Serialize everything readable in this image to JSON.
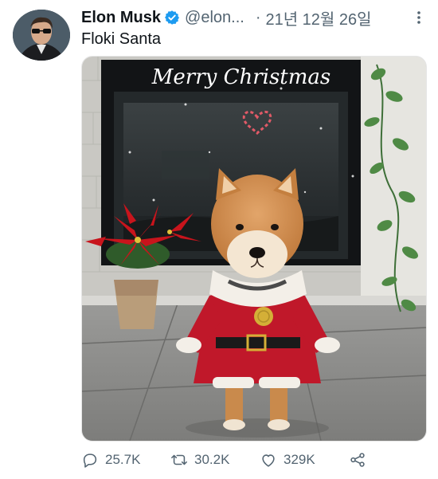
{
  "author": {
    "name": "Elon Musk",
    "handle": "@elon...",
    "verified": true
  },
  "timestamp": "21년 12월 26일",
  "separator": "·",
  "tweet": {
    "text": "Floki Santa",
    "image_overlay_text": "Merry Christmas"
  },
  "actions": {
    "reply_count": "25.7K",
    "retweet_count": "30.2K",
    "like_count": "329K"
  },
  "icons": {
    "more": "more-dots-icon",
    "reply": "reply-bubble-icon",
    "retweet": "retweet-icon",
    "like": "heart-icon",
    "share": "share-icon",
    "verified": "verified-badge-icon"
  },
  "colors": {
    "text": "#0f1419",
    "secondary": "#536471",
    "verified": "#1d9bf0"
  }
}
